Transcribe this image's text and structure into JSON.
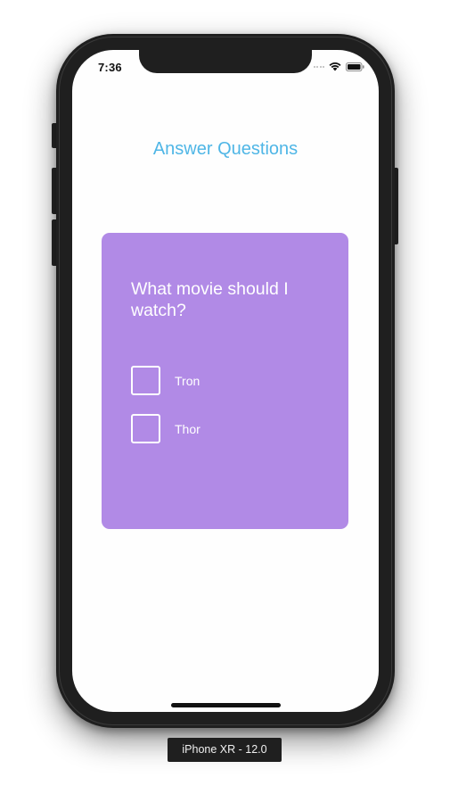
{
  "status_bar": {
    "time": "7:36",
    "icons": [
      "signal-icon",
      "wifi-icon",
      "battery-icon"
    ]
  },
  "screen": {
    "title": "Answer Questions",
    "title_color": "#4fb6e6"
  },
  "card": {
    "background": "#b18ae6",
    "question": "What movie should I watch?",
    "options": [
      {
        "label": "Tron",
        "checked": false
      },
      {
        "label": "Thor",
        "checked": false
      }
    ]
  },
  "device": {
    "label": "iPhone XR - 12.0"
  }
}
